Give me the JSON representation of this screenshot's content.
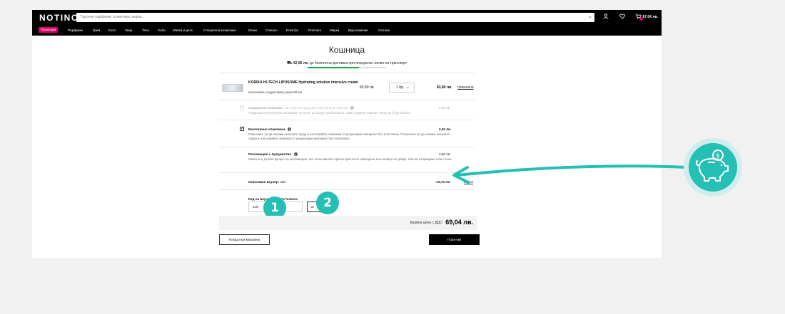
{
  "header": {
    "logo": "NOTINO",
    "search_placeholder": "Търсене парфюми, козметика, марки...",
    "cart_total": "67,04 лв.",
    "icons": [
      "search-icon",
      "user-icon",
      "heart-icon",
      "cart-icon"
    ]
  },
  "nav": {
    "promo": "Промоции",
    "items": [
      "Парфюми",
      "Грим",
      "Коса",
      "Лице",
      "Тяло",
      "Зъби",
      "Майка и дете",
      "Специална козметика",
      "Мъже",
      "Спешно",
      "Електро",
      "Premium",
      "Марки",
      "Вдъхновение",
      "Салони"
    ]
  },
  "page": {
    "title": "Кошница",
    "shipping_amount": "42,96 лв.",
    "shipping_text": "до безплатна доставка при определен начин на транспорт",
    "shipping_progress": 0.65
  },
  "product": {
    "name": "KORIKA HI-TECH LIPOSOME Hydrating solution intensive cream",
    "description": "интензивен хидратиращ крем 50 мл.",
    "unit_price": "83,80 лв.",
    "quantity": "1 бр.",
    "total": "83,80 лв.",
    "remove": "премахни"
  },
  "options": [
    {
      "title": "Подаръчна опаковка",
      "subtitle": "- за отделни продукти или цялата поръчка",
      "desc": "Подаръци в екологично опаковане не могат да бъдат комбинирани. Само единият вариант може да бъде избран.",
      "price": "5,00 лв.",
      "checked": false,
      "disabled": true
    },
    {
      "title": "Екологично опаковане",
      "subtitle": "",
      "desc": "Помогнете ни да опазим околната среда и използвайте опаковка от рециклиран материал без пластмаса. Помогнете ни да опазим околната среда и използвайте опаковка от рециклиран материал без пластмаса.",
      "price": "2,00 лв.",
      "checked": true,
      "disabled": false
    },
    {
      "title": "Рекламация с предимство",
      "subtitle": "",
      "desc": "Избегнете дългия процес на рекламация, ако точно вашата пратка пристигне повредена или изобщо не дойде. Ние ви изпращаме нова стока.",
      "price": "3,50 лв.",
      "checked": false,
      "disabled": false
    }
  ],
  "voucher": {
    "label": "Използван ваучер:",
    "code": "sale",
    "value": "-16,76 лв.",
    "remove": "махни"
  },
  "code_form": {
    "label": "Код на ваучер или отстъпката",
    "value": "sale",
    "button": "ок"
  },
  "badges": [
    "1",
    "2"
  ],
  "summary": {
    "label": "Крайна цена с ДДС:",
    "total": "69,04 лв."
  },
  "actions": {
    "back": "Назад към магазина",
    "order": "Поръчай"
  },
  "colors": {
    "accent": "#24bfb5",
    "promo": "#dc0069",
    "progress": "#1fa34a"
  }
}
